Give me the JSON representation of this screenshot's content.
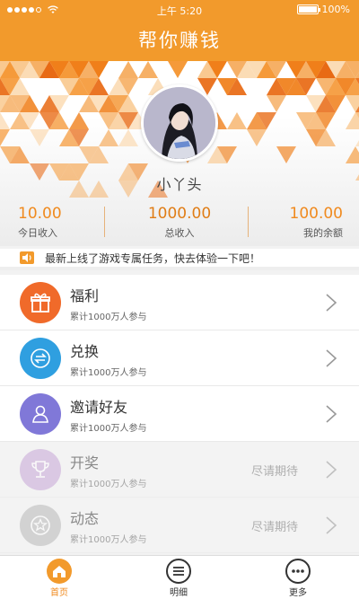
{
  "status_bar": {
    "time": "上午 5:20",
    "battery": "100%",
    "battery_level": 1.0
  },
  "header": {
    "title": "帮你赚钱"
  },
  "profile": {
    "username": "小丫头",
    "stats": [
      {
        "value": "10.00",
        "label": "今日收入"
      },
      {
        "value": "1000.00",
        "label": "总收入"
      },
      {
        "value": "100.00",
        "label": "我的余额"
      }
    ]
  },
  "notice": {
    "text": "最新上线了游戏专属任务，快去体验一下吧！"
  },
  "menu": [
    {
      "title": "福利",
      "subtitle": "累计1000万人参与",
      "status": "",
      "color": "#f06a2a",
      "icon": "gift-icon"
    },
    {
      "title": "兑换",
      "subtitle": "累计1000万人参与",
      "status": "",
      "color": "#2f9fe0",
      "icon": "exchange-icon"
    },
    {
      "title": "邀请好友",
      "subtitle": "累计1000万人参与",
      "status": "",
      "color": "#8078d8",
      "icon": "user-invite-icon"
    },
    {
      "title": "开奖",
      "subtitle": "累计1000万人参与",
      "status": "尽请期待",
      "color": "#c8a6d8",
      "icon": "trophy-icon"
    },
    {
      "title": "动态",
      "subtitle": "累计1000万人参与",
      "status": "尽请期待",
      "color": "#b9b9b9",
      "icon": "star-icon"
    }
  ],
  "tabbar": [
    {
      "label": "首页",
      "icon": "home-icon",
      "active": true
    },
    {
      "label": "明细",
      "icon": "list-icon",
      "active": false
    },
    {
      "label": "更多",
      "icon": "more-icon",
      "active": false
    }
  ],
  "colors": {
    "accent": "#f29a2c",
    "stat_value": "#f08a1e"
  }
}
